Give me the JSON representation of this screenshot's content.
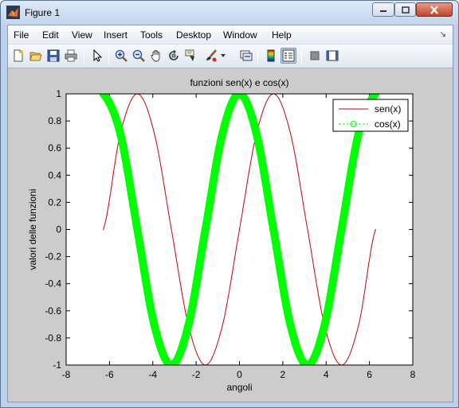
{
  "window": {
    "title": "Figure 1"
  },
  "menubar": {
    "items": [
      "File",
      "Edit",
      "View",
      "Insert",
      "Tools",
      "Desktop",
      "Window",
      "Help"
    ]
  },
  "toolbar": {
    "icons": [
      "new-figure-icon",
      "open-file-icon",
      "save-icon",
      "print-icon",
      "edit-plot-icon",
      "zoom-in-icon",
      "zoom-out-icon",
      "pan-icon",
      "rotate-3d-icon",
      "data-cursor-icon",
      "brush-icon",
      "dropdown-arrow-icon",
      "link-plot-icon",
      "colorbar-icon",
      "legend-icon",
      "hide-plot-tools-icon",
      "show-plot-tools-icon"
    ]
  },
  "colors": {
    "sen": "#cc0000",
    "cos": "#00ff00",
    "axes_bg": "#ffffff",
    "figure_bg": "#cccccc"
  },
  "chart_data": {
    "type": "line",
    "title": "funzioni sen(x) e cos(x)",
    "xlabel": "angoli",
    "ylabel": "valori delle funzioni",
    "xlim": [
      -8,
      8
    ],
    "ylim": [
      -1,
      1
    ],
    "xticks": [
      -8,
      -6,
      -4,
      -2,
      0,
      2,
      4,
      6,
      8
    ],
    "yticks": [
      -1,
      -0.8,
      -0.6,
      -0.4,
      -0.2,
      0,
      0.2,
      0.4,
      0.6,
      0.8,
      1
    ],
    "xtick_labels": [
      "-8",
      "-6",
      "-4",
      "-2",
      "0",
      "2",
      "4",
      "6",
      "8"
    ],
    "ytick_labels": [
      "-1",
      "-0.8",
      "-0.6",
      "-0.4",
      "-0.2",
      "0",
      "0.2",
      "0.4",
      "0.6",
      "0.8",
      "1"
    ],
    "grid": false,
    "legend_position": "top-right",
    "series": [
      {
        "name": "sen(x)",
        "style": "solid",
        "marker": "none",
        "color": "#cc0000",
        "x": [
          -6.283,
          -5.498,
          -4.712,
          -3.927,
          -3.142,
          -2.356,
          -1.571,
          -0.785,
          0,
          0.785,
          1.571,
          2.356,
          3.142,
          3.927,
          4.712,
          5.498,
          6.283
        ],
        "values": [
          0,
          0.707,
          1,
          0.707,
          0,
          -0.707,
          -1,
          -0.707,
          0,
          0.707,
          1,
          0.707,
          0,
          -0.707,
          -1,
          -0.707,
          0
        ]
      },
      {
        "name": "cos(x)",
        "style": "dashed",
        "marker": "circle",
        "color": "#00ff00",
        "x": [
          -6.283,
          -5.498,
          -4.712,
          -3.927,
          -3.142,
          -2.356,
          -1.571,
          -0.785,
          0,
          0.785,
          1.571,
          2.356,
          3.142,
          3.927,
          4.712,
          5.498,
          6.283
        ],
        "values": [
          1,
          0.707,
          0,
          -0.707,
          -1,
          -0.707,
          0,
          0.707,
          1,
          0.707,
          0,
          -0.707,
          -1,
          -0.707,
          0,
          0.707,
          1
        ]
      }
    ]
  }
}
